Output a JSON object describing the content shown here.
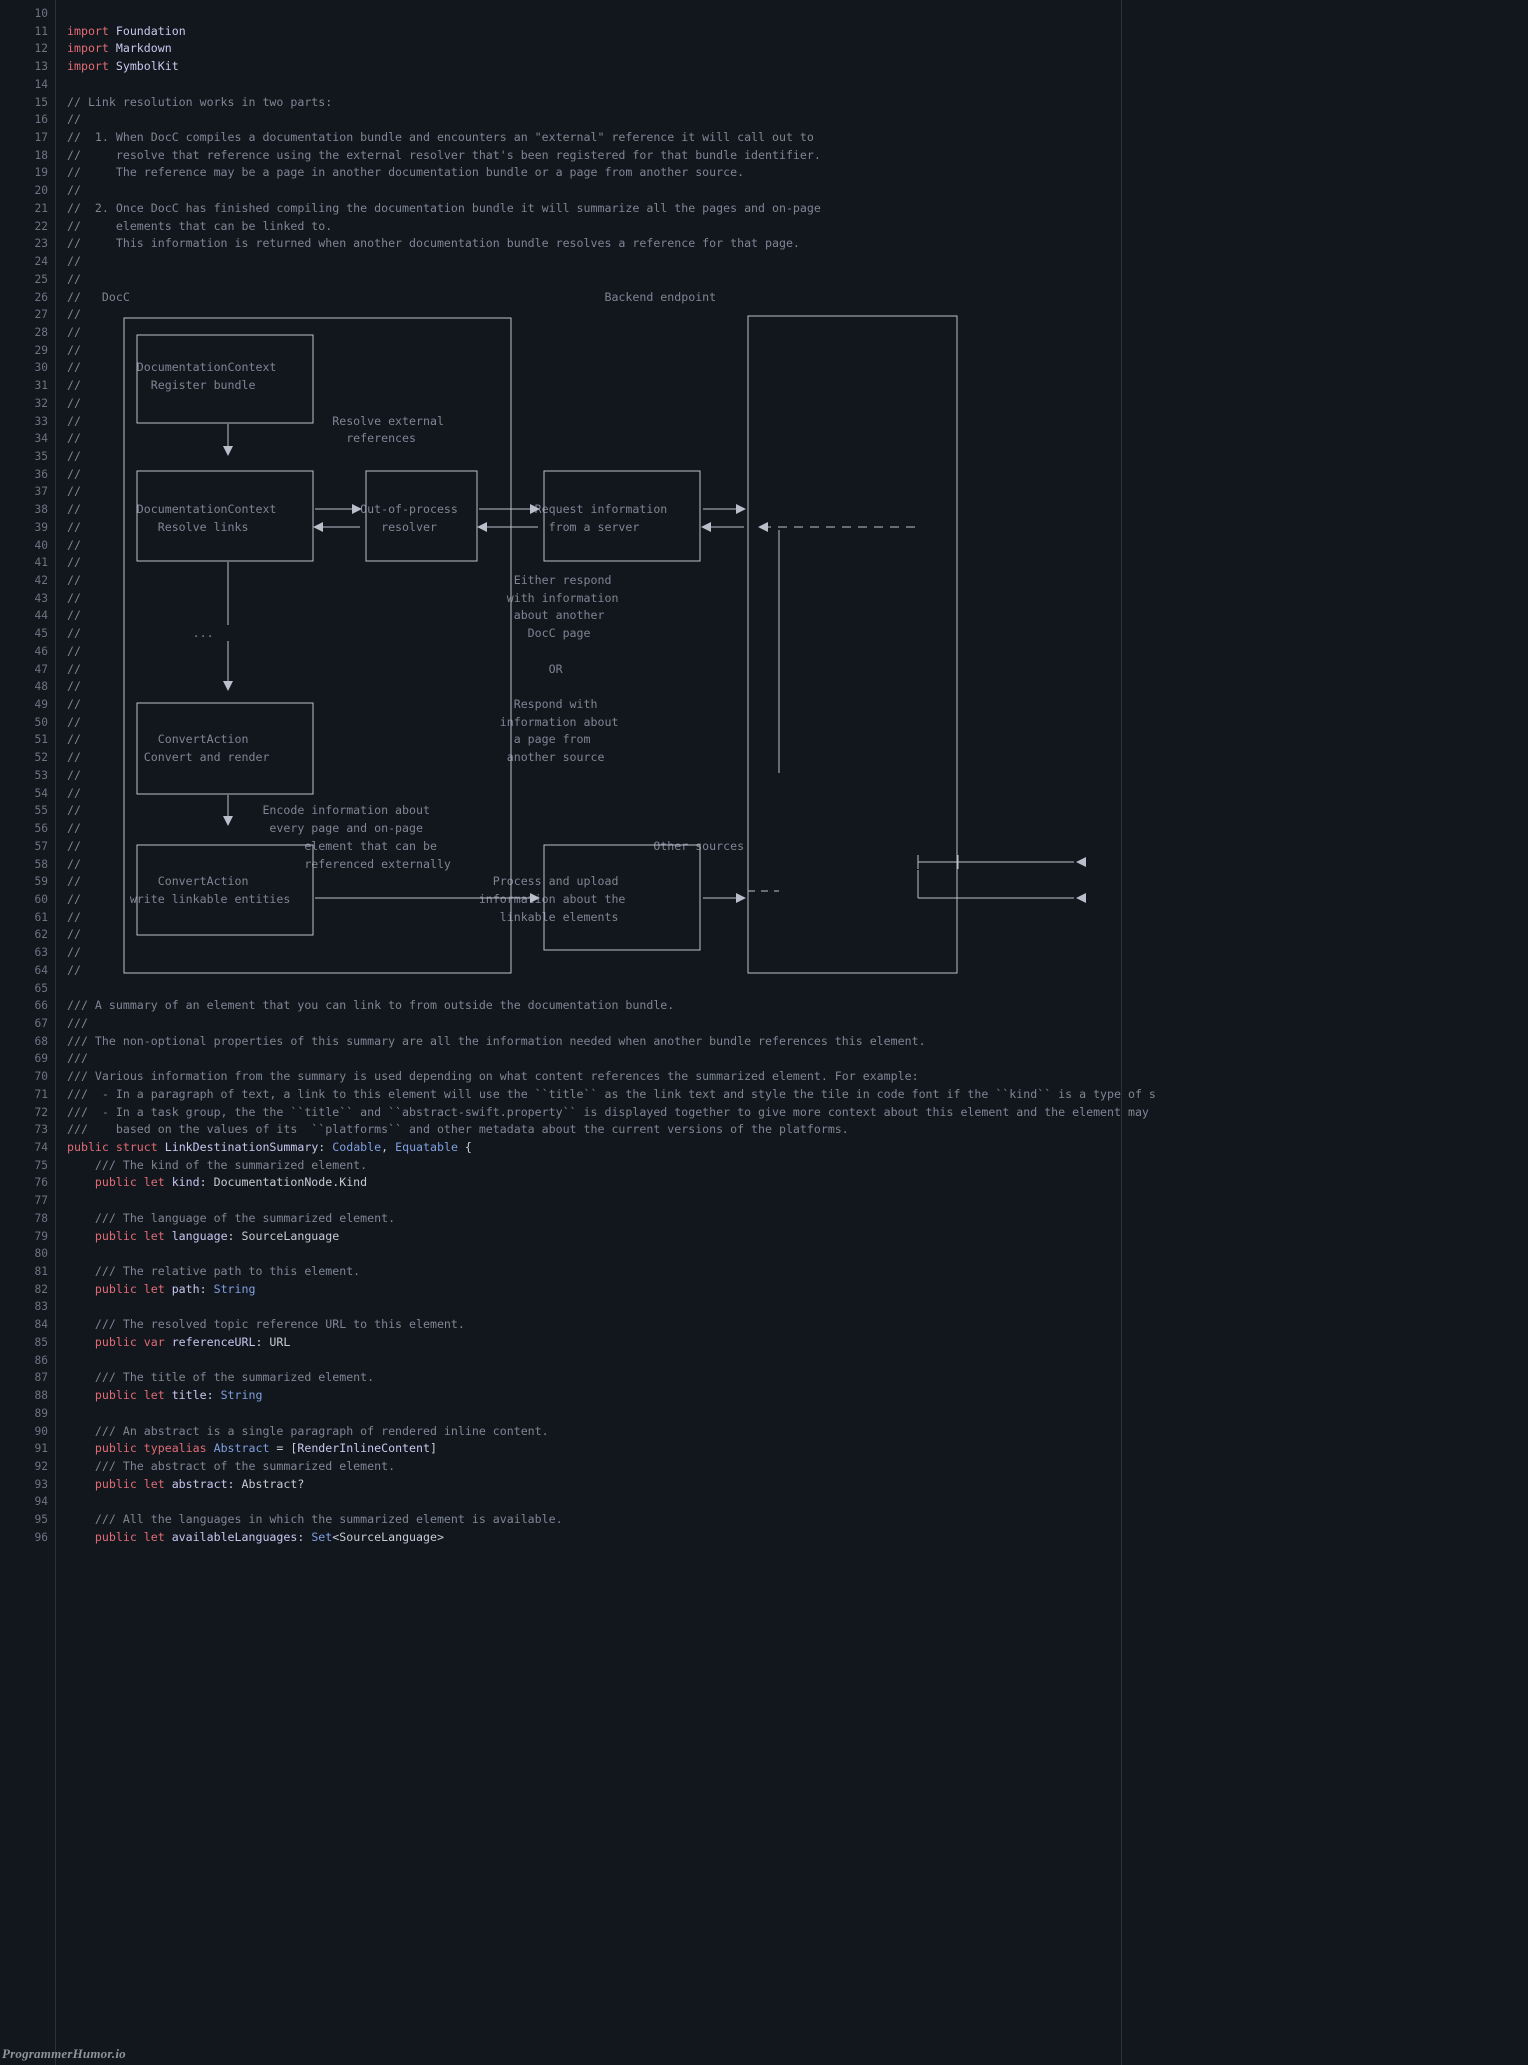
{
  "editor": {
    "background_color": "#12161d",
    "gutter_color": "#6c7683",
    "comment_color": "#7d8694",
    "keyword_color": "#e06c75",
    "type_color": "#7f9fe0",
    "identifier_color": "#c9c6ef",
    "first_line_number": 10,
    "last_line_number": 96,
    "watermark": "ProgrammerHumor.io"
  },
  "lines": [
    {
      "n": 10,
      "tokens": []
    },
    {
      "n": 11,
      "tokens": [
        {
          "c": "kw",
          "t": "import"
        },
        {
          "c": "idn",
          "t": " Foundation"
        }
      ]
    },
    {
      "n": 12,
      "tokens": [
        {
          "c": "kw",
          "t": "import"
        },
        {
          "c": "idn",
          "t": " Markdown"
        }
      ]
    },
    {
      "n": 13,
      "tokens": [
        {
          "c": "kw",
          "t": "import"
        },
        {
          "c": "idn",
          "t": " SymbolKit"
        }
      ]
    },
    {
      "n": 14,
      "tokens": []
    },
    {
      "n": 15,
      "tokens": [
        {
          "c": "cm",
          "t": "// Link resolution works in two parts:"
        }
      ]
    },
    {
      "n": 16,
      "tokens": [
        {
          "c": "cm",
          "t": "//"
        }
      ]
    },
    {
      "n": 17,
      "tokens": [
        {
          "c": "cm",
          "t": "//  1. When DocC compiles a documentation bundle and encounters an \"external\" reference it will call out to"
        }
      ]
    },
    {
      "n": 18,
      "tokens": [
        {
          "c": "cm",
          "t": "//     resolve that reference using the external resolver that's been registered for that bundle identifier."
        }
      ]
    },
    {
      "n": 19,
      "tokens": [
        {
          "c": "cm",
          "t": "//     The reference may be a page in another documentation bundle or a page from another source."
        }
      ]
    },
    {
      "n": 20,
      "tokens": [
        {
          "c": "cm",
          "t": "//"
        }
      ]
    },
    {
      "n": 21,
      "tokens": [
        {
          "c": "cm",
          "t": "//  2. Once DocC has finished compiling the documentation bundle it will summarize all the pages and on-page"
        }
      ]
    },
    {
      "n": 22,
      "tokens": [
        {
          "c": "cm",
          "t": "//     elements that can be linked to."
        }
      ]
    },
    {
      "n": 23,
      "tokens": [
        {
          "c": "cm",
          "t": "//     This information is returned when another documentation bundle resolves a reference for that page."
        }
      ]
    },
    {
      "n": 24,
      "tokens": [
        {
          "c": "cm",
          "t": "//"
        }
      ]
    },
    {
      "n": 25,
      "tokens": [
        {
          "c": "cm",
          "t": "//"
        }
      ]
    },
    {
      "n": 26,
      "tokens": [
        {
          "c": "cm",
          "t": "//   DocC                                                                    Backend endpoint"
        }
      ]
    },
    {
      "n": 27,
      "tokens": [
        {
          "c": "cm",
          "t": "//   ┌───────────────────────────────────────────────────┐                   ┌─────────────────────────┐"
        }
      ]
    },
    {
      "n": 28,
      "tokens": [
        {
          "c": "cm",
          "t": "//   │ ┌───────────────────────┐                         │                   │                         │"
        }
      ]
    },
    {
      "n": 29,
      "tokens": [
        {
          "c": "cm",
          "t": "//   │ │                       │                         │                   │                         │"
        }
      ]
    },
    {
      "n": 30,
      "tokens": [
        {
          "c": "cm",
          "t": "//   │ │  DocumentationContext │                         │                   │                         │"
        }
      ]
    },
    {
      "n": 31,
      "tokens": [
        {
          "c": "cm",
          "t": "//   │ │    Register bundle    │                         │                   │                         │"
        }
      ]
    },
    {
      "n": 32,
      "tokens": [
        {
          "c": "cm",
          "t": "//   │ │                       │                         │                   │                         │"
        }
      ]
    },
    {
      "n": 33,
      "tokens": [
        {
          "c": "cm",
          "t": "//   │ └───────────────────────┘      Resolve external   │                   │                         │"
        }
      ]
    },
    {
      "n": 34,
      "tokens": [
        {
          "c": "cm",
          "t": "//   │             │                    references       │                   │                         │"
        }
      ]
    },
    {
      "n": 35,
      "tokens": [
        {
          "c": "cm",
          "t": "//   │             ▼                                    │                   │                         │"
        }
      ]
    },
    {
      "n": 36,
      "tokens": [
        {
          "c": "cm",
          "t": "//   │ ┌───────────────────────┐   ┌─────────────────┐   │   ┌─────────────────┐                     │"
        }
      ]
    },
    {
      "n": 37,
      "tokens": [
        {
          "c": "cm",
          "t": "//   │ │                       │   │                 │   │   │                 │                     │"
        }
      ]
    },
    {
      "n": 38,
      "tokens": [
        {
          "c": "cm",
          "t": "//   │ │  DocumentationContext │──────▶│  Out-of-process │──────▶│ Request information │──────▶│                 │"
        }
      ]
    },
    {
      "n": 39,
      "tokens": [
        {
          "c": "cm",
          "t": "//   │ │     Resolve links     │◀──────│     resolver    │◀──────│   from a server     │◀──────│◀── ┬ ─────────── "
        }
      ]
    },
    {
      "n": 40,
      "tokens": [
        {
          "c": "cm",
          "t": "//   │ │                       │   │                 │   │   │                 │                     │"
        }
      ]
    },
    {
      "n": 41,
      "tokens": [
        {
          "c": "cm",
          "t": "//   │ └───────────────────────┘   └─────────────────┘   │   │                 │                     │"
        }
      ]
    },
    {
      "n": 42,
      "tokens": [
        {
          "c": "cm",
          "t": "//   │             │                                    │   │   Either respond    │"
        }
      ]
    },
    {
      "n": 43,
      "tokens": [
        {
          "c": "cm",
          "t": "//   │             │                                    │   │  with information   │"
        }
      ]
    },
    {
      "n": 44,
      "tokens": [
        {
          "c": "cm",
          "t": "//   │             │                                    │   │   about another     │"
        }
      ]
    },
    {
      "n": 45,
      "tokens": [
        {
          "c": "cm",
          "t": "//   │            ...                                   │   │     DocC page       │"
        }
      ]
    },
    {
      "n": 46,
      "tokens": [
        {
          "c": "cm",
          "t": "//   │             │                                    │   │                     │"
        }
      ]
    },
    {
      "n": 47,
      "tokens": [
        {
          "c": "cm",
          "t": "//   │             │                                    │   │        OR           │"
        }
      ]
    },
    {
      "n": 48,
      "tokens": [
        {
          "c": "cm",
          "t": "//   │             ▼                                    │   │                     │"
        }
      ]
    },
    {
      "n": 49,
      "tokens": [
        {
          "c": "cm",
          "t": "//   │ ┌───────────────────────┐                        │   │   Respond with      │"
        }
      ]
    },
    {
      "n": 50,
      "tokens": [
        {
          "c": "cm",
          "t": "//   │ │                       │                        │   │ information about   │"
        }
      ]
    },
    {
      "n": 51,
      "tokens": [
        {
          "c": "cm",
          "t": "//   │ │     ConvertAction     │                        │   │   a page from       │"
        }
      ]
    },
    {
      "n": 52,
      "tokens": [
        {
          "c": "cm",
          "t": "//   │ │   Convert and render  │                        │   │  another source     │"
        }
      ]
    },
    {
      "n": 53,
      "tokens": [
        {
          "c": "cm",
          "t": "//   │ │                       │                        │   │                     │"
        }
      ]
    },
    {
      "n": 54,
      "tokens": [
        {
          "c": "cm",
          "t": "//   │ └───────────────────────┘                        │   │                     │"
        }
      ]
    },
    {
      "n": 55,
      "tokens": [
        {
          "c": "cm",
          "t": "//   │             │        Encode information about  │   │                     │"
        }
      ]
    },
    {
      "n": 56,
      "tokens": [
        {
          "c": "cm",
          "t": "//   │             ▼         every page and on-page   │   │                     │"
        }
      ]
    },
    {
      "n": 57,
      "tokens": [
        {
          "c": "cm",
          "t": "//   │ ┌───────────────────────┐  element that can be  │   ┌─────────────────┐ │    Other sources"
        }
      ]
    },
    {
      "n": 58,
      "tokens": [
        {
          "c": "cm",
          "t": "//   │ │                       │  referenced externally│   │                 │ ├───┤◀──────────────────"
        }
      ]
    },
    {
      "n": 59,
      "tokens": [
        {
          "c": "cm",
          "t": "//   │ │     ConvertAction     │                       │   │ Process and upload │  │"
        }
      ]
    },
    {
      "n": 60,
      "tokens": [
        {
          "c": "cm",
          "t": "//   │ │ write linkable entities │──────────────────────▶│ information about the │──────▶├───◀──────────────────"
        }
      ]
    },
    {
      "n": 61,
      "tokens": [
        {
          "c": "cm",
          "t": "//   │ │                       │                       │   │  linkable elements │  │"
        }
      ]
    },
    {
      "n": 62,
      "tokens": [
        {
          "c": "cm",
          "t": "//   │ └───────────────────────┘                       │   │                 │ │"
        }
      ]
    },
    {
      "n": 63,
      "tokens": [
        {
          "c": "cm",
          "t": "//   │                                                 │   └─────────────────┘ │"
        }
      ]
    },
    {
      "n": 64,
      "tokens": [
        {
          "c": "cm",
          "t": "//   └─────────────────────────────────────────────────┘   └─────────────────────┘"
        }
      ]
    },
    {
      "n": 65,
      "tokens": []
    },
    {
      "n": 66,
      "tokens": [
        {
          "c": "cm",
          "t": "/// A summary of an element that you can link to from outside the documentation bundle."
        }
      ]
    },
    {
      "n": 67,
      "tokens": [
        {
          "c": "cm",
          "t": "///"
        }
      ]
    },
    {
      "n": 68,
      "tokens": [
        {
          "c": "cm",
          "t": "/// The non-optional properties of this summary are all the information needed when another bundle references this element."
        }
      ]
    },
    {
      "n": 69,
      "tokens": [
        {
          "c": "cm",
          "t": "///"
        }
      ]
    },
    {
      "n": 70,
      "tokens": [
        {
          "c": "cm",
          "t": "/// Various information from the summary is used depending on what content references the summarized element. For example:"
        }
      ]
    },
    {
      "n": 71,
      "tokens": [
        {
          "c": "cm",
          "t": "///  - In a paragraph of text, a link to this element will use the ``title`` as the link text and style the tile in code font if the ``kind`` is a type of s"
        }
      ]
    },
    {
      "n": 72,
      "tokens": [
        {
          "c": "cm",
          "t": "///  - In a task group, the the ``title`` and ``abstract-swift.property`` is displayed together to give more context about this element and the element may"
        }
      ]
    },
    {
      "n": 73,
      "tokens": [
        {
          "c": "cm",
          "t": "///    based on the values of its  ``platforms`` and other metadata about the current versions of the platforms."
        }
      ]
    },
    {
      "n": 74,
      "tokens": [
        {
          "c": "kw",
          "t": "public struct "
        },
        {
          "c": "idn",
          "t": "LinkDestinationSummary"
        },
        {
          "c": "pln",
          "t": ": "
        },
        {
          "c": "typ",
          "t": "Codable"
        },
        {
          "c": "pln",
          "t": ", "
        },
        {
          "c": "typ",
          "t": "Equatable"
        },
        {
          "c": "pln",
          "t": " {"
        }
      ]
    },
    {
      "n": 75,
      "tokens": [
        {
          "c": "cm",
          "t": "    /// The kind of the summarized element."
        }
      ]
    },
    {
      "n": 76,
      "tokens": [
        {
          "c": "pln",
          "t": "    "
        },
        {
          "c": "kw",
          "t": "public let "
        },
        {
          "c": "idn",
          "t": "kind"
        },
        {
          "c": "pln",
          "t": ": DocumentationNode.Kind"
        }
      ]
    },
    {
      "n": 77,
      "tokens": []
    },
    {
      "n": 78,
      "tokens": [
        {
          "c": "cm",
          "t": "    /// The language of the summarized element."
        }
      ]
    },
    {
      "n": 79,
      "tokens": [
        {
          "c": "pln",
          "t": "    "
        },
        {
          "c": "kw",
          "t": "public let "
        },
        {
          "c": "idn",
          "t": "language"
        },
        {
          "c": "pln",
          "t": ": SourceLanguage"
        }
      ]
    },
    {
      "n": 80,
      "tokens": []
    },
    {
      "n": 81,
      "tokens": [
        {
          "c": "cm",
          "t": "    /// The relative path to this element."
        }
      ]
    },
    {
      "n": 82,
      "tokens": [
        {
          "c": "pln",
          "t": "    "
        },
        {
          "c": "kw",
          "t": "public let "
        },
        {
          "c": "idn",
          "t": "path"
        },
        {
          "c": "pln",
          "t": ": "
        },
        {
          "c": "typ",
          "t": "String"
        }
      ]
    },
    {
      "n": 83,
      "tokens": []
    },
    {
      "n": 84,
      "tokens": [
        {
          "c": "cm",
          "t": "    /// The resolved topic reference URL to this element."
        }
      ]
    },
    {
      "n": 85,
      "tokens": [
        {
          "c": "pln",
          "t": "    "
        },
        {
          "c": "kw",
          "t": "public var "
        },
        {
          "c": "idn",
          "t": "referenceURL"
        },
        {
          "c": "pln",
          "t": ": URL"
        }
      ]
    },
    {
      "n": 86,
      "tokens": []
    },
    {
      "n": 87,
      "tokens": [
        {
          "c": "cm",
          "t": "    /// The title of the summarized element."
        }
      ]
    },
    {
      "n": 88,
      "tokens": [
        {
          "c": "pln",
          "t": "    "
        },
        {
          "c": "kw",
          "t": "public let "
        },
        {
          "c": "idn",
          "t": "title"
        },
        {
          "c": "pln",
          "t": ": "
        },
        {
          "c": "typ",
          "t": "String"
        }
      ]
    },
    {
      "n": 89,
      "tokens": []
    },
    {
      "n": 90,
      "tokens": [
        {
          "c": "cm",
          "t": "    /// An abstract is a single paragraph of rendered inline content."
        }
      ]
    },
    {
      "n": 91,
      "tokens": [
        {
          "c": "pln",
          "t": "    "
        },
        {
          "c": "kw",
          "t": "public typealias "
        },
        {
          "c": "typ",
          "t": "Abstract"
        },
        {
          "c": "pln",
          "t": " = ["
        },
        {
          "c": "idn",
          "t": "RenderInlineContent"
        },
        {
          "c": "pln",
          "t": "]"
        }
      ]
    },
    {
      "n": 92,
      "tokens": [
        {
          "c": "cm",
          "t": "    /// The abstract of the summarized element."
        }
      ]
    },
    {
      "n": 93,
      "tokens": [
        {
          "c": "pln",
          "t": "    "
        },
        {
          "c": "kw",
          "t": "public let "
        },
        {
          "c": "idn",
          "t": "abstract"
        },
        {
          "c": "pln",
          "t": ": Abstract?"
        }
      ]
    },
    {
      "n": 94,
      "tokens": []
    },
    {
      "n": 95,
      "tokens": [
        {
          "c": "cm",
          "t": "    /// All the languages in which the summarized element is available."
        }
      ]
    },
    {
      "n": 96,
      "tokens": [
        {
          "c": "pln",
          "t": "    "
        },
        {
          "c": "kw",
          "t": "public let "
        },
        {
          "c": "idn",
          "t": "availableLanguages"
        },
        {
          "c": "pln",
          "t": ": "
        },
        {
          "c": "typ",
          "t": "Set"
        },
        {
          "c": "pln",
          "t": "<SourceLanguage>"
        }
      ]
    }
  ],
  "diagram": {
    "title_left": "DocC",
    "title_right": "Backend endpoint",
    "boxes": [
      {
        "id": "register-bundle",
        "lines": [
          "DocumentationContext",
          "Register bundle"
        ]
      },
      {
        "id": "resolve-links",
        "lines": [
          "DocumentationContext",
          "Resolve links"
        ]
      },
      {
        "id": "out-of-process-resolver",
        "lines": [
          "Out-of-process",
          "resolver"
        ]
      },
      {
        "id": "request-information",
        "lines": [
          "Request information",
          "from a server"
        ]
      },
      {
        "id": "convert-and-render",
        "lines": [
          "ConvertAction",
          "Convert and render"
        ]
      },
      {
        "id": "write-linkable-entities",
        "lines": [
          "ConvertAction",
          "write linkable entities"
        ]
      },
      {
        "id": "process-and-upload",
        "lines": [
          "Process and upload",
          "information about the",
          "linkable elements"
        ]
      }
    ],
    "labels": [
      {
        "id": "resolve-external-references",
        "lines": [
          "Resolve external",
          "references"
        ]
      },
      {
        "id": "ellipsis",
        "lines": [
          "..."
        ]
      },
      {
        "id": "encode-information",
        "lines": [
          "Encode information about",
          "every page and on-page",
          "element that can be",
          "referenced externally"
        ]
      },
      {
        "id": "either-respond",
        "lines": [
          "Either respond",
          "with information",
          "about another",
          "DocC page",
          "OR",
          "Respond with",
          "information about",
          "a page from",
          "another source"
        ]
      },
      {
        "id": "other-sources",
        "lines": [
          "Other sources"
        ]
      }
    ]
  }
}
